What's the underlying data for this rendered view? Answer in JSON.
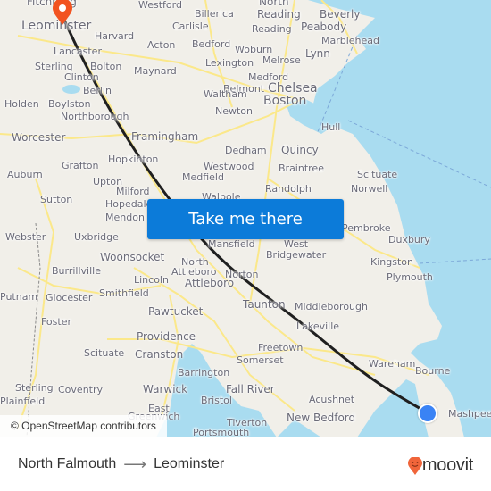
{
  "map": {
    "attribution": "© OpenStreetMap contributors",
    "cta_label": "Take me there",
    "colors": {
      "land": "#f1efe9",
      "water": "#a9dcf0",
      "road": "#fbe88a",
      "route": "#1f1f1f",
      "cta": "#0c7bd9",
      "origin": "#3a83f5",
      "destination": "#f25320"
    },
    "origin_label": "North Falmouth",
    "destination_label": "Leominster",
    "places": [
      {
        "name": "Fitchburg",
        "text": "Fitchburg"
      },
      {
        "name": "Leominster",
        "text": "Leominster"
      },
      {
        "name": "Westford",
        "text": "Westford"
      },
      {
        "name": "Billerica",
        "text": "Billerica"
      },
      {
        "name": "North Reading",
        "text": "North"
      },
      {
        "name": "North Reading 2",
        "text": "Reading"
      },
      {
        "name": "Beverly",
        "text": "Beverly"
      },
      {
        "name": "Harvard",
        "text": "Harvard"
      },
      {
        "name": "Carlisle",
        "text": "Carlisle"
      },
      {
        "name": "Reading",
        "text": "Reading"
      },
      {
        "name": "Peabody",
        "text": "Peabody"
      },
      {
        "name": "Marblehead",
        "text": "Marblehead"
      },
      {
        "name": "Lancaster",
        "text": "Lancaster"
      },
      {
        "name": "Acton",
        "text": "Acton"
      },
      {
        "name": "Bedford",
        "text": "Bedford"
      },
      {
        "name": "Woburn",
        "text": "Woburn"
      },
      {
        "name": "Lynn",
        "text": "Lynn"
      },
      {
        "name": "Melrose",
        "text": "Melrose"
      },
      {
        "name": "Sterling",
        "text": "Sterling"
      },
      {
        "name": "Bolton",
        "text": "Bolton"
      },
      {
        "name": "Maynard",
        "text": "Maynard"
      },
      {
        "name": "Lexington",
        "text": "Lexington"
      },
      {
        "name": "Clinton",
        "text": "Clinton"
      },
      {
        "name": "Medford",
        "text": "Medford"
      },
      {
        "name": "Chelsea",
        "text": "Chelsea"
      },
      {
        "name": "Berlin",
        "text": "Berlin"
      },
      {
        "name": "Belmont",
        "text": "Belmont"
      },
      {
        "name": "Waltham",
        "text": "Waltham"
      },
      {
        "name": "Holden",
        "text": "Holden"
      },
      {
        "name": "Boylston",
        "text": "Boylston"
      },
      {
        "name": "Boston",
        "text": "Boston"
      },
      {
        "name": "Newton",
        "text": "Newton"
      },
      {
        "name": "Northborough",
        "text": "Northborough"
      },
      {
        "name": "Hull",
        "text": "Hull"
      },
      {
        "name": "Worcester",
        "text": "Worcester"
      },
      {
        "name": "Framingham",
        "text": "Framingham"
      },
      {
        "name": "Quincy",
        "text": "Quincy"
      },
      {
        "name": "Dedham",
        "text": "Dedham"
      },
      {
        "name": "Hopkinton",
        "text": "Hopkinton"
      },
      {
        "name": "Grafton",
        "text": "Grafton"
      },
      {
        "name": "Westwood",
        "text": "Westwood"
      },
      {
        "name": "Braintree",
        "text": "Braintree"
      },
      {
        "name": "Auburn",
        "text": "Auburn"
      },
      {
        "name": "Scituate MA",
        "text": "Scituate"
      },
      {
        "name": "Medfield",
        "text": "Medfield"
      },
      {
        "name": "Upton",
        "text": "Upton"
      },
      {
        "name": "Norwell",
        "text": "Norwell"
      },
      {
        "name": "Randolph",
        "text": "Randolph"
      },
      {
        "name": "Walpole",
        "text": "Walpole"
      },
      {
        "name": "Milford",
        "text": "Milford"
      },
      {
        "name": "Sutton",
        "text": "Sutton"
      },
      {
        "name": "Hopedale",
        "text": "Hopedale"
      },
      {
        "name": "Mendon",
        "text": "Mendon"
      },
      {
        "name": "Pembroke",
        "text": "Pembroke"
      },
      {
        "name": "Webster",
        "text": "Webster"
      },
      {
        "name": "Uxbridge",
        "text": "Uxbridge"
      },
      {
        "name": "Mansfield",
        "text": "Mansfield"
      },
      {
        "name": "West Bridgewater",
        "text": "West"
      },
      {
        "name": "West Bridgewater 2",
        "text": "Bridgewater"
      },
      {
        "name": "Duxbury",
        "text": "Duxbury"
      },
      {
        "name": "Woonsocket",
        "text": "Woonsocket"
      },
      {
        "name": "North Attleboro",
        "text": "North"
      },
      {
        "name": "North Attleboro 2",
        "text": "Attleboro"
      },
      {
        "name": "Norton",
        "text": "Norton"
      },
      {
        "name": "Kingston",
        "text": "Kingston"
      },
      {
        "name": "Burrillville",
        "text": "Burrillville"
      },
      {
        "name": "Lincoln",
        "text": "Lincoln"
      },
      {
        "name": "Attleboro",
        "text": "Attleboro"
      },
      {
        "name": "Plymouth",
        "text": "Plymouth"
      },
      {
        "name": "Putnam",
        "text": "Putnam"
      },
      {
        "name": "Glocester",
        "text": "Glocester"
      },
      {
        "name": "Smithfield",
        "text": "Smithfield"
      },
      {
        "name": "Taunton",
        "text": "Taunton"
      },
      {
        "name": "Middleborough",
        "text": "Middleborough"
      },
      {
        "name": "Pawtucket",
        "text": "Pawtucket"
      },
      {
        "name": "Foster",
        "text": "Foster"
      },
      {
        "name": "Lakeville",
        "text": "Lakeville"
      },
      {
        "name": "Providence",
        "text": "Providence"
      },
      {
        "name": "Freetown",
        "text": "Freetown"
      },
      {
        "name": "Scituate RI",
        "text": "Scituate"
      },
      {
        "name": "Cranston",
        "text": "Cranston"
      },
      {
        "name": "Somerset",
        "text": "Somerset"
      },
      {
        "name": "Wareham",
        "text": "Wareham"
      },
      {
        "name": "Bourne",
        "text": "Bourne"
      },
      {
        "name": "Barrington",
        "text": "Barrington"
      },
      {
        "name": "Sterling CT",
        "text": "Sterling"
      },
      {
        "name": "Coventry",
        "text": "Coventry"
      },
      {
        "name": "Warwick",
        "text": "Warwick"
      },
      {
        "name": "Fall River",
        "text": "Fall River"
      },
      {
        "name": "Plainfield",
        "text": "Plainfield"
      },
      {
        "name": "Bristol",
        "text": "Bristol"
      },
      {
        "name": "Acushnet",
        "text": "Acushnet"
      },
      {
        "name": "East Greenwich",
        "text": "East"
      },
      {
        "name": "East Greenwich 2",
        "text": "Greenwich"
      },
      {
        "name": "Mashpee",
        "text": "Mashpee"
      },
      {
        "name": "New Bedford",
        "text": "New Bedford"
      },
      {
        "name": "Tiverton",
        "text": "Tiverton"
      },
      {
        "name": "Portsmouth",
        "text": "Portsmouth"
      }
    ]
  },
  "footer": {
    "origin": "North Falmouth",
    "arrow_icon": "arrow-right-icon",
    "destination": "Leominster",
    "brand": "moovit"
  }
}
